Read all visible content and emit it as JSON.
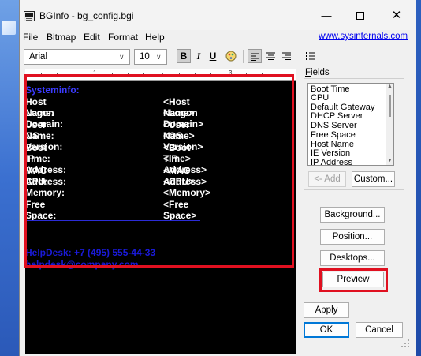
{
  "window": {
    "title": "BGInfo - bg_config.bgi",
    "controls": {
      "minimize": "—",
      "close": "✕"
    }
  },
  "menu": {
    "items": [
      "File",
      "Bitmap",
      "Edit",
      "Format",
      "Help"
    ],
    "link": "www.sysinternals.com"
  },
  "toolbar": {
    "font": "Arial",
    "size": "10",
    "bold": "B",
    "italic": "I",
    "underline": "U"
  },
  "ruler": {
    "numbers": [
      "1",
      "2",
      "3"
    ]
  },
  "editor": {
    "header": "Systeminfo:",
    "rows": [
      {
        "label": "Host Name:",
        "value": "<Host Name>"
      },
      {
        "label": "Logon Domain:",
        "value": "<Logon Domain>"
      },
      {
        "label": "User Name:",
        "value": "<User Name>"
      },
      {
        "label": "OS Version:",
        "value": "<OS Version>"
      },
      {
        "label": "Boot Time:",
        "value": "<Boot Time>"
      },
      {
        "label": "IP Address:",
        "value": "<IP Address>"
      },
      {
        "label": "MAC Address:",
        "value": "<MAC Address>"
      },
      {
        "label": "CPU:",
        "value": "<CPU>"
      },
      {
        "label": "Memory:",
        "value": "<Memory>"
      },
      {
        "label": "Free Space:",
        "value": "<Free Space>"
      }
    ],
    "footer_line1": "HelpDesk: +7 (495) 555-44-33",
    "footer_line2": "helpdesk@company.com"
  },
  "fields": {
    "label_prefix": "",
    "label_underlined": "F",
    "label_rest": "ields",
    "items": [
      "Boot Time",
      "CPU",
      "Default Gateway",
      "DHCP Server",
      "DNS Server",
      "Free Space",
      "Host Name",
      "IE Version",
      "IP Address"
    ],
    "add_button": "<- Add",
    "custom_button": "Custom..."
  },
  "buttons": {
    "background": "Background...",
    "position": "Position...",
    "desktops": "Desktops...",
    "preview": "Preview",
    "apply": "Apply",
    "ok": "OK",
    "cancel": "Cancel"
  },
  "colors": {
    "editor_bg": "#000000",
    "editor_text": "#ffffff",
    "editor_accent": "#3b3bff",
    "highlight_box": "#e01020",
    "default_button_border": "#0078d7"
  }
}
